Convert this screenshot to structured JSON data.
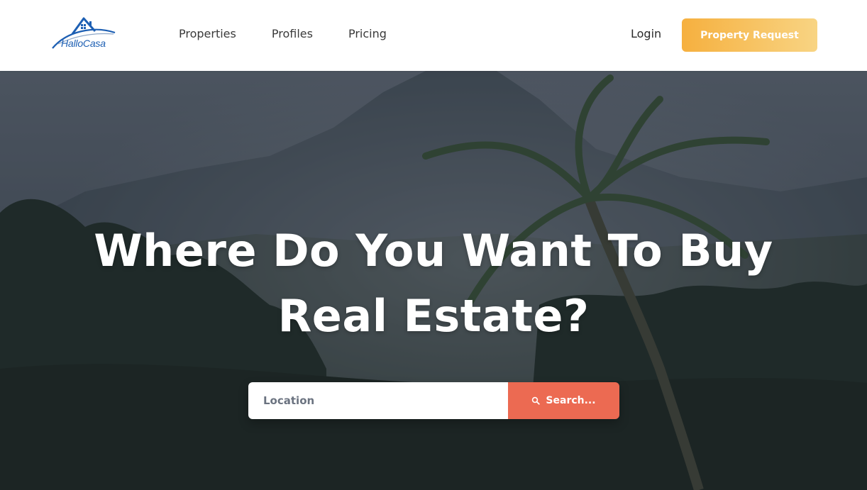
{
  "brand": {
    "name": "HalloCasa",
    "color": "#1d5fb3"
  },
  "nav": {
    "items": [
      {
        "label": "Properties"
      },
      {
        "label": "Profiles"
      },
      {
        "label": "Pricing"
      }
    ],
    "login_label": "Login",
    "cta_label": "Property Request",
    "cta_color": "#f6b03f"
  },
  "hero": {
    "title_line1": "Where Do You Want To Buy",
    "title_line2": "Real Estate?",
    "search": {
      "placeholder": "Location",
      "value": "",
      "button_label": "Search...",
      "button_icon": "search-icon",
      "button_color": "#ec6a52"
    }
  }
}
